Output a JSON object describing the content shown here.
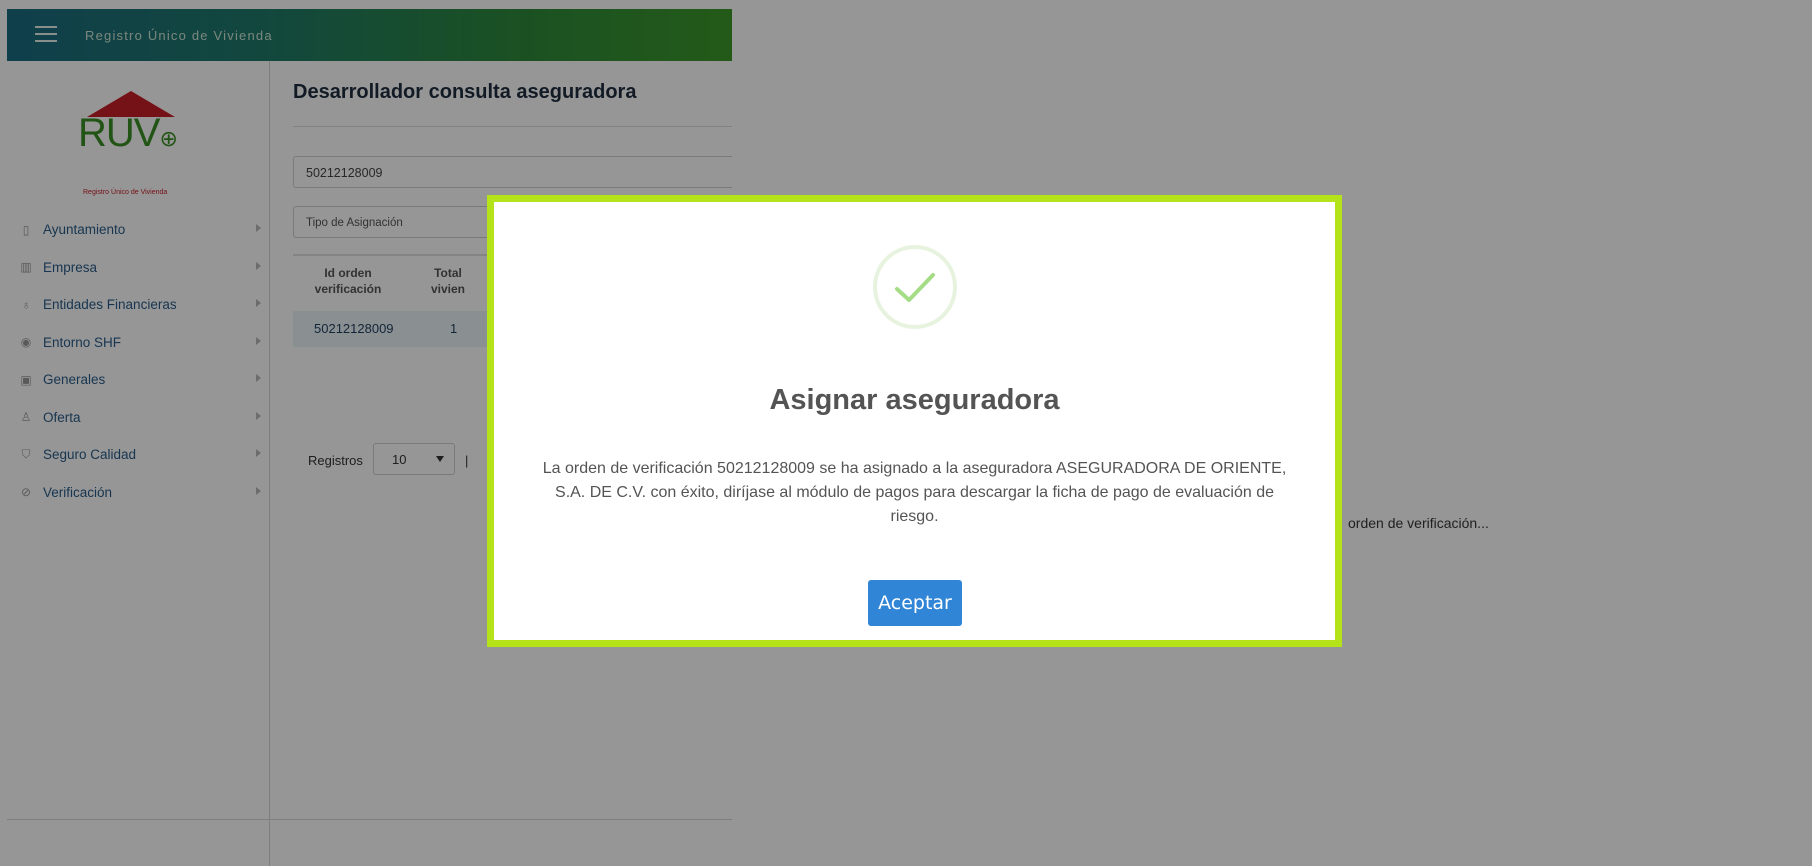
{
  "app": {
    "title": "Registro Único de Vivienda"
  },
  "logo": {
    "text": "RUV",
    "subtitle": "Registro Único de Vivienda",
    "brand_red": "#c8202a",
    "brand_green": "#3b8f24"
  },
  "sidebar": {
    "items": [
      {
        "label": "Ayuntamiento",
        "icon": "map-icon"
      },
      {
        "label": "Empresa",
        "icon": "building-icon"
      },
      {
        "label": "Entidades Financieras",
        "icon": "people-icon"
      },
      {
        "label": "Entorno SHF",
        "icon": "target-icon"
      },
      {
        "label": "Generales",
        "icon": "image-icon"
      },
      {
        "label": "Oferta",
        "icon": "user-icon"
      },
      {
        "label": "Seguro Calidad",
        "icon": "shield-icon"
      },
      {
        "label": "Verificación",
        "icon": "check-circle-icon"
      }
    ]
  },
  "main": {
    "page_title": "Desarrollador consulta aseguradora",
    "search_value": "50212128009",
    "tipo_placeholder": "Tipo de Asignación",
    "table": {
      "headers": [
        "Id orden verificación",
        "Total vivien"
      ],
      "rows": [
        [
          "50212128009",
          "1"
        ]
      ]
    },
    "pagination": {
      "registros_label": "Registros",
      "page_size": "10",
      "separator": "|"
    }
  },
  "background_hint": "orden de verificación...",
  "modal": {
    "title": "Asignar aseguradora",
    "message": "La orden de verificación 50212128009 se ha asignado a la aseguradora ASEGURADORA DE ORIENTE, S.A. DE C.V. con éxito, diríjase al módulo de pagos para descargar la ficha de pago de evaluación de riesgo.",
    "accept_label": "Aceptar",
    "icon": "success-check-icon",
    "border_color": "#b5e31a",
    "button_color": "#3085d6"
  }
}
